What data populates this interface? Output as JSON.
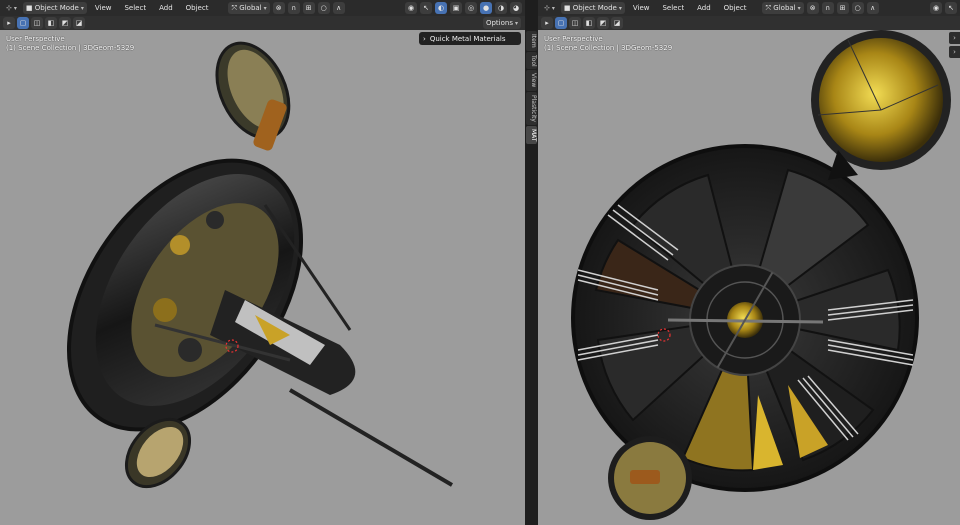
{
  "left_view": {
    "mode": "Object Mode",
    "menus": [
      "View",
      "Select",
      "Add",
      "Object"
    ],
    "orientation": "Global",
    "options_label": "Options",
    "perspective": "User Perspective",
    "collection": "(1) Scene Collection | 3DGeom-5329",
    "panel_label": "Quick Metal Materials"
  },
  "sidebar_tabs": [
    "Item",
    "Tool",
    "View",
    "Plasticity",
    "MAT"
  ],
  "right_view": {
    "mode": "Object Mode",
    "menus": [
      "View",
      "Select",
      "Add",
      "Object"
    ],
    "orientation": "Global",
    "perspective": "User Perspective",
    "collection": "(1) Scene Collection | 3DGeom-5329"
  },
  "icons": {
    "editor_type": "axes-icon",
    "mode": "cube-icon",
    "transform": "gizmo-icon",
    "snap": "magnet-icon",
    "proportional": "circle-icon",
    "shading": "sphere-icon",
    "cursor": "3d-cursor-icon"
  },
  "colors": {
    "viewport_bg": "#9c9c9c",
    "header_bg": "#2b2b2b",
    "accent": "#4772b3",
    "gold": "#c9a227"
  }
}
